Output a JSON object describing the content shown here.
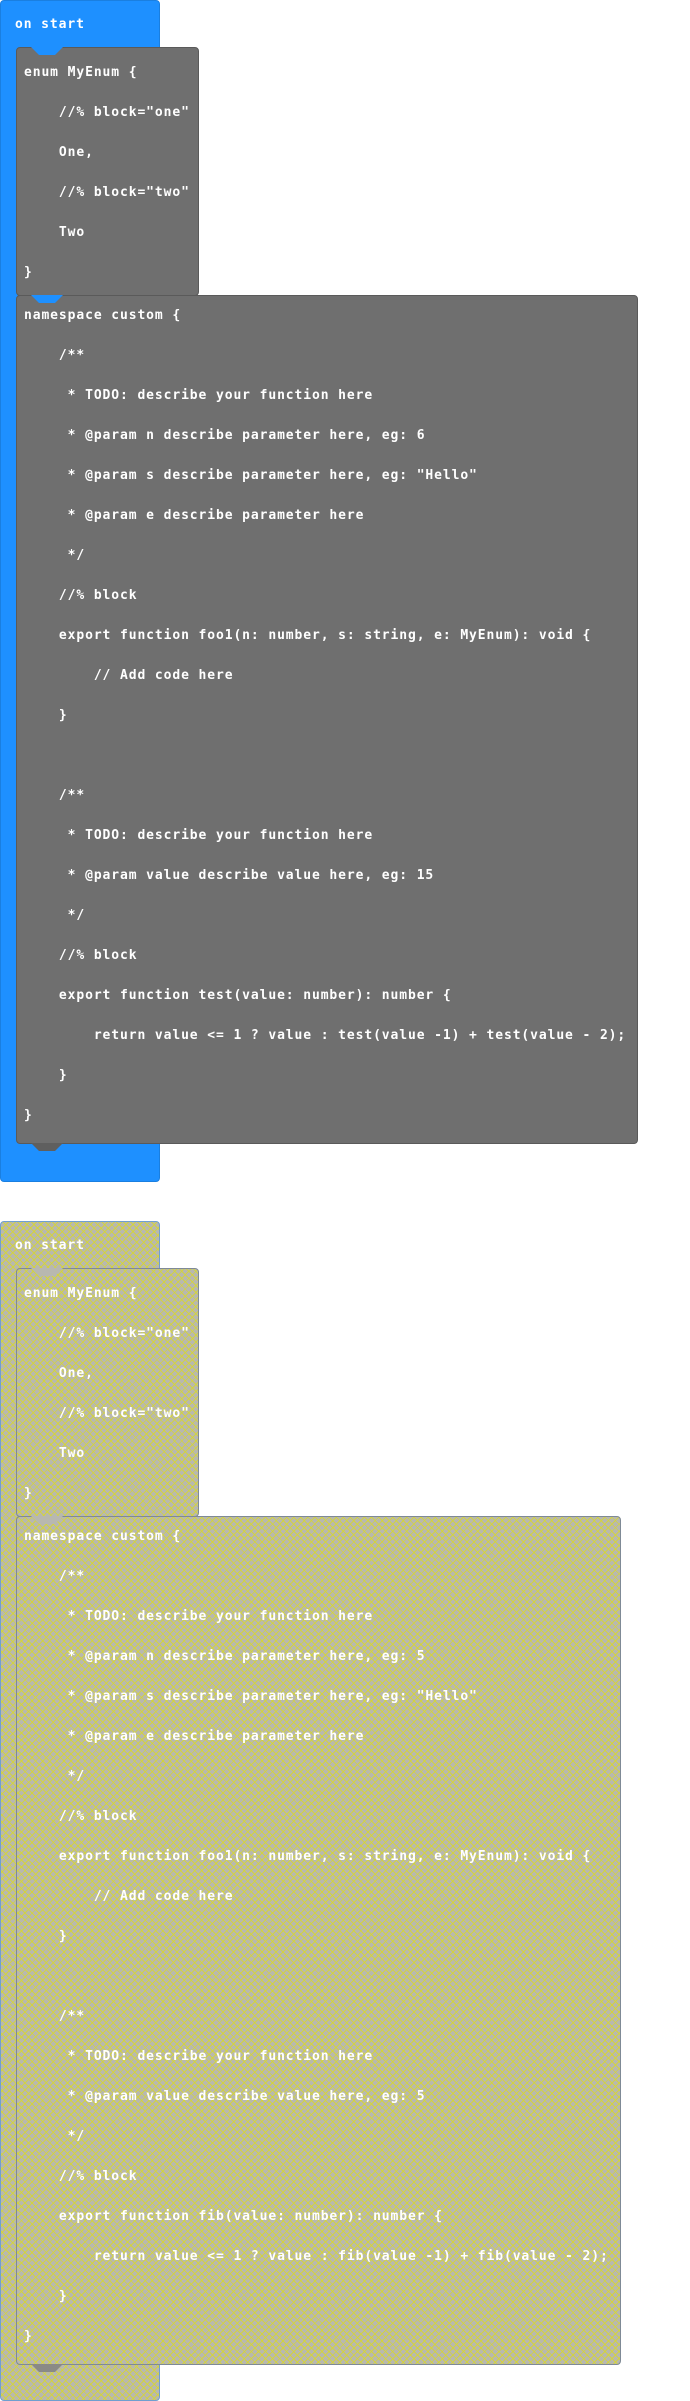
{
  "workspace": [
    {
      "state": "enabled",
      "event_label": "on start",
      "enum_lines": [
        "enum MyEnum {",
        "    //% block=\"one\"",
        "    One,",
        "    //% block=\"two\"",
        "    Two",
        "}"
      ],
      "namespace_lines": [
        "namespace custom {",
        "    /**",
        "     * TODO: describe your function here",
        "     * @param n describe parameter here, eg: 6",
        "     * @param s describe parameter here, eg: \"Hello\"",
        "     * @param e describe parameter here",
        "     */",
        "    //% block",
        "    export function foo1(n: number, s: string, e: MyEnum): void {",
        "        // Add code here",
        "    }",
        "",
        "    /**",
        "     * TODO: describe your function here",
        "     * @param value describe value here, eg: 15",
        "     */",
        "    //% block",
        "    export function test(value: number): number {",
        "        return value <= 1 ? value : test(value -1) + test(value - 2);",
        "    }",
        "}"
      ]
    },
    {
      "state": "disabled",
      "event_label": "on start",
      "enum_lines": [
        "enum MyEnum {",
        "    //% block=\"one\"",
        "    One,",
        "    //% block=\"two\"",
        "    Two",
        "}"
      ],
      "namespace_lines": [
        "namespace custom {",
        "    /**",
        "     * TODO: describe your function here",
        "     * @param n describe parameter here, eg: 5",
        "     * @param s describe parameter here, eg: \"Hello\"",
        "     * @param e describe parameter here",
        "     */",
        "    //% block",
        "    export function foo1(n: number, s: string, e: MyEnum): void {",
        "        // Add code here",
        "    }",
        "",
        "    /**",
        "     * TODO: describe your function here",
        "     * @param value describe value here, eg: 5",
        "     */",
        "    //% block",
        "    export function fib(value: number): number {",
        "        return value <= 1 ? value : fib(value -1) + fib(value - 2);",
        "    }",
        "}"
      ]
    }
  ],
  "colors": {
    "event_blue": "#1e90ff",
    "code_gray": "#6f6f6f",
    "disabled_hatch": "#d6d632"
  }
}
